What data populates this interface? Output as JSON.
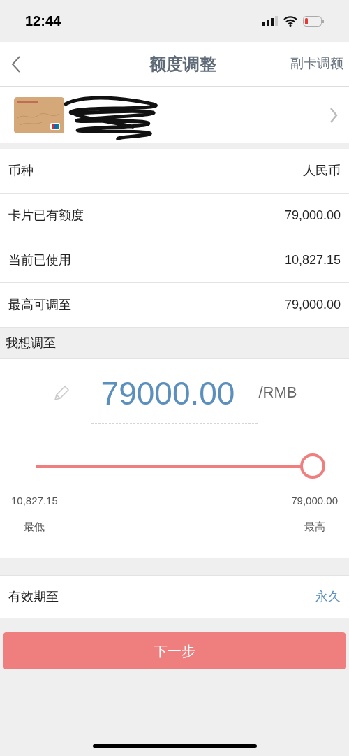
{
  "status_bar": {
    "time": "12:44"
  },
  "nav": {
    "title": "额度调整",
    "action": "副卡调额"
  },
  "rows": [
    {
      "label": "币种",
      "value": "人民币"
    },
    {
      "label": "卡片已有额度",
      "value": "79,000.00"
    },
    {
      "label": "当前已使用",
      "value": "10,827.15"
    },
    {
      "label": "最高可调至",
      "value": "79,000.00"
    }
  ],
  "adjust": {
    "heading": "我想调至",
    "amount": "79000.00",
    "unit": "/RMB",
    "slider": {
      "level": 1
    },
    "min_value": "10,827.15",
    "min_label": "最低",
    "max_value": "79,000.00",
    "max_label": "最高"
  },
  "validity": {
    "label": "有效期至",
    "value": "永久"
  },
  "next_button": "下一步"
}
